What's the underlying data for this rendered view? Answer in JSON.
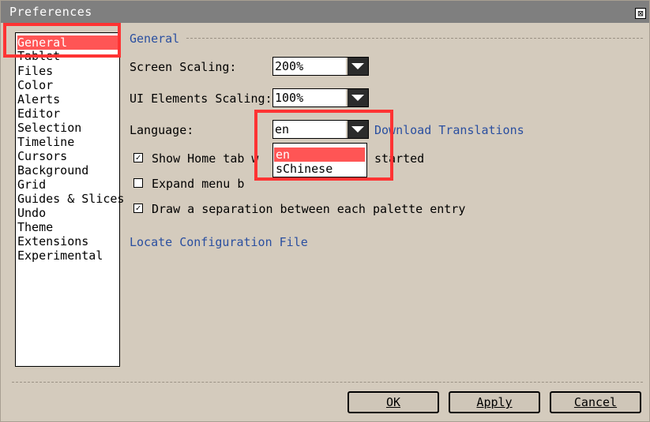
{
  "window": {
    "title": "Preferences",
    "close_glyph": "⊠"
  },
  "sidebar": {
    "items": [
      {
        "label": "General",
        "selected": true
      },
      {
        "label": "Files"
      },
      {
        "label": "Color"
      },
      {
        "label": "Alerts"
      },
      {
        "label": "Editor"
      },
      {
        "label": "Selection"
      },
      {
        "label": "Timeline"
      },
      {
        "label": "Cursors"
      },
      {
        "label": "Background"
      },
      {
        "label": "Grid"
      },
      {
        "label": "Guides & Slices"
      },
      {
        "label": "Undo"
      },
      {
        "label": "Theme"
      },
      {
        "label": "Extensions"
      },
      {
        "label": "Experimental"
      }
    ],
    "partially_hidden_item": "Tablet"
  },
  "general": {
    "group_label": "General",
    "screen_scaling": {
      "label": "Screen Scaling:",
      "value": "200%"
    },
    "ui_scaling": {
      "label": "UI Elements Scaling:",
      "value": "100%"
    },
    "language": {
      "label": "Language:",
      "value": "en",
      "download_link": "Download Translations",
      "options": [
        "en",
        "sChinese"
      ]
    },
    "show_home": {
      "label": "Show Home tab w",
      "label_tail": "started",
      "checked": true
    },
    "expand_menu": {
      "label": "Expand menu b",
      "checked": false
    },
    "draw_separation": {
      "label": "Draw a separation between each palette entry",
      "checked": true
    },
    "locate_config": "Locate Configuration File"
  },
  "buttons": {
    "ok": "OK",
    "apply": "Apply",
    "cancel": "Cancel"
  },
  "colors": {
    "highlight": "#ff3333",
    "selection": "#ff5555",
    "link": "#2a4fa0"
  }
}
